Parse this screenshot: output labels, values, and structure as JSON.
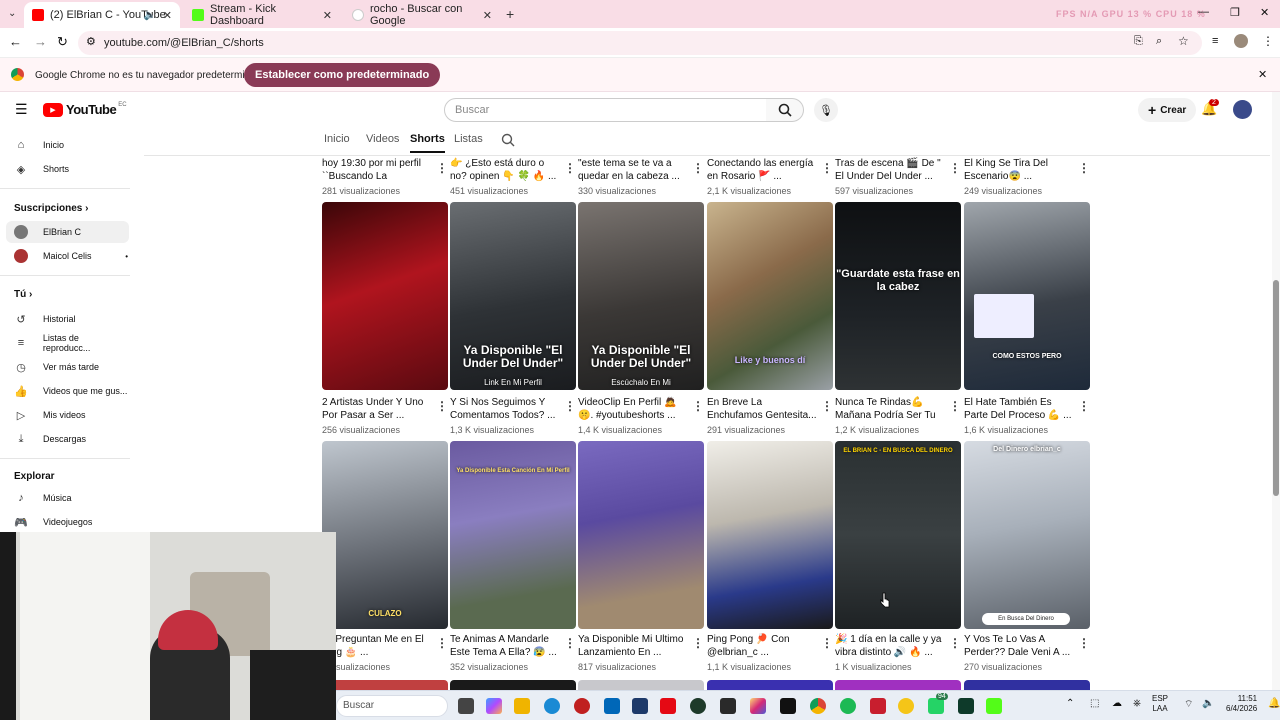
{
  "browser": {
    "tabs": [
      {
        "title": "(2) ElBrian C - YouTube",
        "color": "#ff0000"
      },
      {
        "title": "Stream - Kick Dashboard",
        "color": "#53fc18"
      },
      {
        "title": "rocho - Buscar con Google",
        "color": "#4285f4"
      }
    ],
    "url": "youtube.com/@ElBrian_C/shorts",
    "perf": "FPS N/A   GPU 13 %   CPU 18 %"
  },
  "banner": {
    "text": "Google Chrome no es tu navegador predeterminado",
    "button": "Establecer como predeterminado"
  },
  "yt": {
    "logo": "YouTube",
    "logo_suffix": "EC",
    "search_placeholder": "Buscar",
    "create": "Crear",
    "notif_count": "2"
  },
  "channel_tabs": [
    "Inicio",
    "Videos",
    "Shorts",
    "Listas"
  ],
  "sidebar": {
    "main": [
      "Inicio",
      "Shorts"
    ],
    "subs_title": "Suscripciones",
    "subs": [
      "ElBrian C",
      "Maicol Celis"
    ],
    "you_title": "Tú",
    "you": [
      "Historial",
      "Listas de reproducc...",
      "Ver más tarde",
      "Videos que me gus...",
      "Mis videos",
      "Descargas"
    ],
    "explore_title": "Explorar",
    "explore": [
      "Música",
      "Videojuegos"
    ]
  },
  "row0": [
    {
      "title": "hoy 19:30 por mi perfil ``Buscando La Money``...",
      "views": "281 visualizaciones"
    },
    {
      "title": "👉 ¿Esto está duro o no? opinen 👇 🍀 🔥 ...",
      "views": "451 visualizaciones"
    },
    {
      "title": "\"este tema se te va a quedar en la cabeza ...",
      "views": "330 visualizaciones"
    },
    {
      "title": "Conectando las energía en Rosario 🚩 ...",
      "views": "2,1 K visualizaciones"
    },
    {
      "title": "Tras de escena 🎬 De \" El Under Del Under ...",
      "views": "597 visualizaciones"
    },
    {
      "title": "El King Se Tira Del Escenario😨 ...",
      "views": "249 visualizaciones"
    }
  ],
  "row1": [
    {
      "title": "2 Artistas Under Y Uno Por Pasar a Ser ...",
      "views": "256 visualizaciones",
      "overlay": ""
    },
    {
      "title": "Y Si Nos Seguimos Y Comentamos Todos? ...",
      "views": "1,3 K visualizaciones",
      "overlay": "Ya Disponible \"El Under Del Under\"",
      "overlay2": "Link En Mi Perfil"
    },
    {
      "title": "VideoClip En Perfil 🙇 🤫. #youtubeshorts ...",
      "views": "1,4 K visualizaciones",
      "overlay": "Ya Disponible \"El Under Del Under\"",
      "overlay2": "Escúchalo En Mi"
    },
    {
      "title": "En Breve La Enchufamos Gentesita...",
      "views": "291 visualizaciones",
      "overlay": "",
      "overlay2": "Like y buenos dí"
    },
    {
      "title": "Nunca Te Rindas💪 Mañana Podría Ser Tu ...",
      "views": "1,2 K visualizaciones",
      "overlay": "\"Guardate esta frase en la cabez",
      "overlay2": ""
    },
    {
      "title": "El Hate También Es Parte Del Proceso 💪 ...",
      "views": "1,6 K visualizaciones",
      "overlay": "",
      "overlay2": "COMO ESTOS PERO"
    }
  ],
  "row2": [
    {
      "title": "Te Preguntan Me en El King 🎂 ...",
      "views": "5 visualizaciones",
      "overlay": "",
      "overlay2": "CULAZO"
    },
    {
      "title": "Te Animas A Mandarle Este Tema A Ella? 😰 ...",
      "views": "352 visualizaciones",
      "overlay": "Ya Disponible Esta Canción En Mi Perfil",
      "overlay2": ""
    },
    {
      "title": "Ya Disponible Mi Ultimo Lanzamiento En ...",
      "views": "817 visualizaciones",
      "overlay": "",
      "overlay2": ""
    },
    {
      "title": "Ping Pong 🏓 Con @elbrian_c ...",
      "views": "1,1 K visualizaciones",
      "overlay": "",
      "overlay2": ""
    },
    {
      "title": "🎉 1 día en la calle y ya vibra distinto 🔊 🔥 ...",
      "views": "1 K visualizaciones",
      "overlay": "EL BRIAN C - EN BUSCA DEL DINERO",
      "overlay2": ""
    },
    {
      "title": "Y Vos Te Lo Vas A Perder?? Dale Veni A ...",
      "views": "270 visualizaciones",
      "overlay": "Del Dinero elbrian_c",
      "overlay2": "En Busca Del Dinero"
    }
  ],
  "taskbar": {
    "search": "Buscar",
    "lang": "ESP",
    "lang2": "LAA",
    "time": "11:51",
    "date": "6/4/2026",
    "badge": "94"
  }
}
